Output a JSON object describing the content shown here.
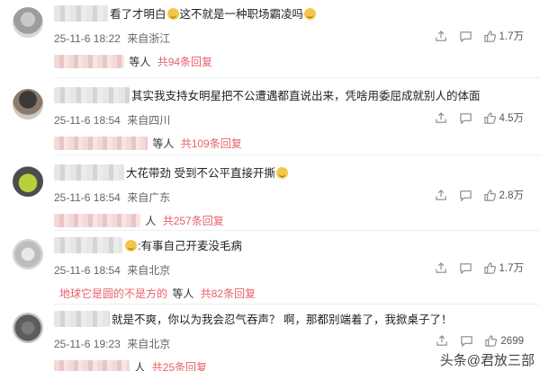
{
  "comments": [
    {
      "text": "看了才明白",
      "text2": "这不就是一种职场霸凌吗",
      "date": "25-11-6 18:22",
      "location": "来自浙江",
      "likes": "1.7万",
      "reply_who": "等人",
      "reply_link": "共94条回复"
    },
    {
      "text": "其实我支持女明星把不公遭遇都直说出来，凭啥用委屈成就别人的体面",
      "date": "25-11-6 18:54",
      "location": "来自四川",
      "likes": "4.5万",
      "reply_who": "等人",
      "reply_link": "共109条回复"
    },
    {
      "text": "大花带劲 受到不公平直接开撕",
      "date": "25-11-6 18:54",
      "location": "来自广东",
      "likes": "2.8万",
      "reply_who": "人",
      "reply_link": "共257条回复"
    },
    {
      "text": ":有事自己开麦没毛病",
      "date": "25-11-6 18:54",
      "location": "来自北京",
      "likes": "1.7万",
      "reply_name": "地球它是圆的不是方的",
      "reply_who": "等人",
      "reply_link": "共82条回复"
    },
    {
      "text": "就是不爽，你以为我会忍气吞声？ 啊，那都别端着了，我掀桌子了！",
      "date": "25-11-6 19:23",
      "location": "来自北京",
      "likes": "2699",
      "reply_who": "人",
      "reply_link": "共25条回复"
    }
  ],
  "watermark": "头条@君放三部",
  "icons": [
    "share-icon",
    "comment-icon",
    "like-icon"
  ]
}
